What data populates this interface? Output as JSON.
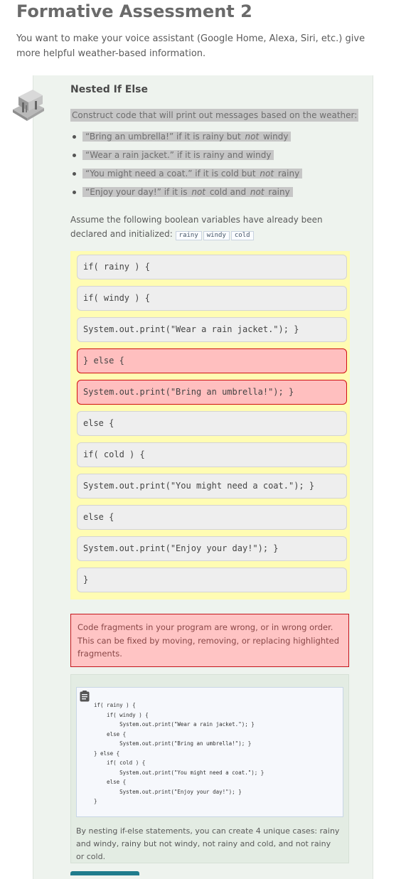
{
  "page": {
    "title": "Formative Assessment 2",
    "intro": "You want to make your voice assistant (Google Home, Alexa, Siri, etc.) give more helpful weather-based information."
  },
  "activity": {
    "title": "Nested If Else",
    "prompt": "Construct code that will print out messages based on the weather:",
    "bullets": [
      {
        "a": "“Bring an umbrella!” if it is rainy but ",
        "em": "not",
        "b": " windy",
        "c": ""
      },
      {
        "a": "“Wear a rain jacket.” if it is rainy and windy",
        "em": "",
        "b": "",
        "c": ""
      },
      {
        "a": "“You might need a coat.” if it is cold but ",
        "em": "not",
        "b": " rainy",
        "c": ""
      },
      {
        "a": "“Enjoy your day!” if it is ",
        "em": "not",
        "b": " cold and ",
        "em2": "not",
        "c": " rainy"
      }
    ],
    "assume_text": "Assume the following boolean variables have already been declared and initialized:",
    "variables": [
      "rainy",
      "windy",
      "cold"
    ]
  },
  "blocks": [
    {
      "code": "if( rainy ) {",
      "state": "normal"
    },
    {
      "code": "if( windy ) {",
      "state": "normal"
    },
    {
      "code": "System.out.print(\"Wear a rain jacket.\"); }",
      "state": "normal"
    },
    {
      "code": "} else {",
      "state": "error"
    },
    {
      "code": "System.out.print(\"Bring an umbrella!\"); }",
      "state": "error"
    },
    {
      "code": "else {",
      "state": "normal"
    },
    {
      "code": "if( cold ) {",
      "state": "normal"
    },
    {
      "code": "System.out.print(\"You might need a coat.\"); }",
      "state": "normal"
    },
    {
      "code": "else {",
      "state": "normal"
    },
    {
      "code": "System.out.print(\"Enjoy your day!\"); }",
      "state": "normal"
    },
    {
      "code": "}",
      "state": "normal"
    }
  ],
  "feedback": "Code fragments in your program are wrong, or in wrong order. This can be fixed by moving, removing, or replacing highlighted fragments.",
  "solution": {
    "lines": [
      "if( rainy ) {",
      "    if( windy ) {",
      "        System.out.print(\"Wear a rain jacket.\"); }",
      "    else {",
      "        System.out.print(\"Bring an umbrella!\"); }",
      "} else {",
      "    if( cold ) {",
      "        System.out.print(\"You might need a coat.\"); }",
      "    else {",
      "        System.out.print(\"Enjoy your day!\"); }",
      "}"
    ],
    "explanation": "By nesting if-else statements, you can create 4 unique cases: rainy and windy, rainy but not windy, not rainy and cold, and not rainy or cold."
  },
  "colors": {
    "workspace": "#fffcb3",
    "error_fill": "#ffbfbf",
    "error_border": "#d01010",
    "card": "#eef3ee",
    "button": "#1f7c8c"
  },
  "icons": [
    "activity-bench-icon",
    "clipboard-copy-icon"
  ]
}
